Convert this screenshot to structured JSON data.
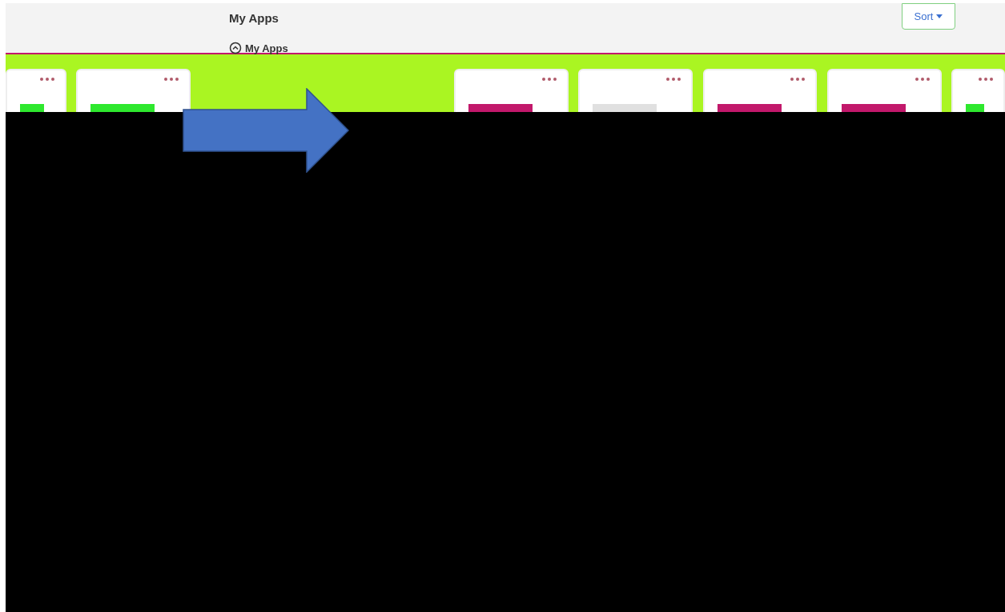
{
  "header": {
    "title": "My Apps",
    "sort_button": "Sort"
  },
  "section": {
    "title": "My Apps",
    "expanded": true
  },
  "cards": [
    {
      "color": "#2ee82e"
    },
    {
      "color": "#2ee82e"
    },
    {
      "color": "#c2186b"
    },
    {
      "color": "#e0e0e0"
    },
    {
      "color": "#c2186b"
    },
    {
      "color": "#c2186b"
    },
    {
      "color": "#2ee82e"
    }
  ]
}
